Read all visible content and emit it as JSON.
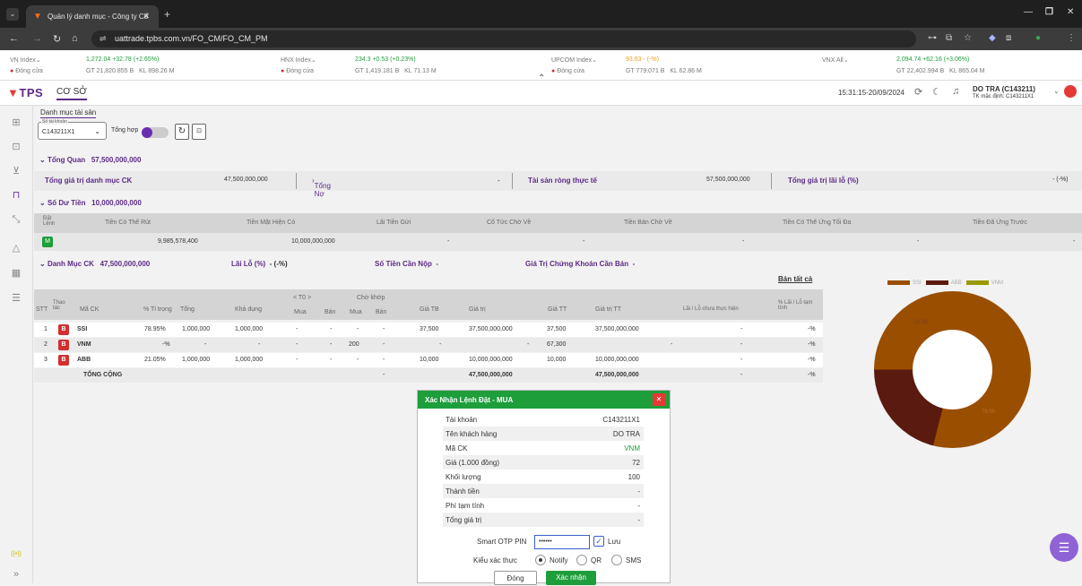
{
  "browser": {
    "tab_title": "Quản lý danh mục - Công ty Cổ",
    "url": "uattrade.tpbs.com.vn/FO_CM/FO_CM_PM"
  },
  "ticker": [
    {
      "name": "VN Index",
      "change": "1,272.04  +32.78  (+2.65%)",
      "state": "Đóng cửa",
      "gt": "GT 21,820.855 B",
      "kl": "KL 898.26 M"
    },
    {
      "name": "HNX Index",
      "change": "234.3  +0.53  (+0.23%)",
      "state": "Đóng cửa",
      "gt": "GT 1,419.181 B",
      "kl": "KL 71.13 M"
    },
    {
      "name": "UPCOM Index",
      "change": "93.63  -  (-%)",
      "state": "Đóng cửa",
      "gt": "GT 779.071 B",
      "kl": "KL 62.86 M"
    },
    {
      "name": "VNX All",
      "change": "2,094.74  +62.16  (+3.06%)",
      "state": "",
      "gt": "GT 22,402.994 B",
      "kl": "KL 865.04 M"
    }
  ],
  "header": {
    "logo": "TPS",
    "menu": "CƠ SỞ",
    "datetime": "15:31:15-20/09/2024",
    "user": "DO TRA (C143211)",
    "default_account": "TK mặc định: C143211X1"
  },
  "page": {
    "subtab": "Danh mục tài sản",
    "account_label": "Số tài khoản",
    "account": "C143211X1",
    "aggregate_label": "Tổng hợp",
    "overview_label": "Tổng Quan",
    "overview_value": "57,500,000,000",
    "overview": {
      "total_portfolio_label": "Tổng giá trị danh mục CK",
      "total_portfolio": "47,500,000,000",
      "debt_label": "Tổng Nợ",
      "debt_value": "-",
      "net_assets_label": "Tài sản ròng thực tế",
      "net_assets": "57,500,000,000",
      "pnl_label": "Tổng giá trị lãi lỗ (%)",
      "pnl_value": "- (-%)"
    },
    "cash_label": "Số Dư Tiền",
    "cash_value": "10,000,000,000",
    "cash_headers": [
      "Đặt Lệnh",
      "Tiền Có Thể Rút",
      "Tiền Mặt Hiện Có",
      "Lãi Tiền Gửi",
      "Cổ Tức Chờ Về",
      "Tiền Bán Chờ Về",
      "Tiền Có Thể Ứng Tối Đa",
      "Tiền Đã Ứng Trước"
    ],
    "cash_row": {
      "order_btn": "M",
      "withdrawable": "9,985,578,400",
      "cash": "10,000,000,000",
      "interest": "-",
      "dividend": "-",
      "sell_pending": "-",
      "max_advance": "-",
      "advanced": "-"
    },
    "portfolio_label": "Danh Mục CK",
    "portfolio_value": "47,500,000,000",
    "pnl_pct_label": "Lãi Lỗ (%)",
    "pnl_pct_value": "- (-%)",
    "pay_label": "Số Tiền Cần Nộp",
    "pay_value": "-",
    "sell_label": "Giá Trị Chứng Khoán Cần Bán",
    "sell_value": "-",
    "sell_all": "Bán tất cả",
    "headers": {
      "stt": "STT",
      "action": "Thao tác",
      "symbol": "Mã CK",
      "weight": "% Tỉ trọng",
      "total": "Tổng",
      "available": "Khả dụng",
      "t0": "< T0 >",
      "buy": "Mua",
      "sell": "Bán",
      "matching": "Chờ khớp",
      "buy2": "Mua",
      "sell2": "Bán",
      "avg": "Giá TB",
      "value": "Giá trị",
      "price": "Giá TT",
      "mvalue": "Giá trị TT",
      "pnl": "Lãi / Lỗ chưa thực hiện",
      "pnl_pct": "% Lãi / Lỗ tạm tính"
    },
    "rows": [
      {
        "stt": "1",
        "act": "B",
        "sym": "SSI",
        "w": "78.95%",
        "total": "1,000,000",
        "avail": "1,000,000",
        "t0b": "-",
        "t0s": "-",
        "mb": "-",
        "ms": "-",
        "avg": "37,500",
        "val": "37,500,000,000",
        "price": "37,500",
        "mval": "37,500,000,000",
        "pnl": "-",
        "pct": "-%"
      },
      {
        "stt": "2",
        "act": "B",
        "sym": "VNM",
        "w": "-%",
        "total": "-",
        "avail": "-",
        "t0b": "-",
        "t0s": "-",
        "mb": "200",
        "ms": "-",
        "avg": "-",
        "val": "-",
        "price": "67,300",
        "mval": "-",
        "pnl": "-",
        "pct": "-%"
      },
      {
        "stt": "3",
        "act": "B",
        "sym": "ABB",
        "w": "21.05%",
        "total": "1,000,000",
        "avail": "1,000,000",
        "t0b": "-",
        "t0s": "-",
        "mb": "-",
        "ms": "-",
        "avg": "10,000",
        "val": "10,000,000,000",
        "price": "10,000",
        "mval": "10,000,000,000",
        "pnl": "-",
        "pct": "-%"
      }
    ],
    "total_row": {
      "label": "TỔNG CỘNG",
      "mb": "-",
      "val": "47,500,000,000",
      "mval": "47,500,000,000",
      "pnl": "-",
      "pct": "-%"
    }
  },
  "chart_data": {
    "type": "pie",
    "categories": [
      "SSI",
      "ABB",
      "VNM"
    ],
    "values": [
      78.95,
      21.05,
      0
    ],
    "labels": [
      "78.95",
      "21.05"
    ],
    "colors": [
      "#9a4e00",
      "#5a1a10",
      "#9a9a00"
    ],
    "legend_position": "top"
  },
  "modal": {
    "title": "Xác Nhận Lệnh Đặt - MUA",
    "rows": [
      {
        "k": "Tài khoản",
        "v": "C143211X1"
      },
      {
        "k": "Tên khách hàng",
        "v": "DO TRA"
      },
      {
        "k": "Mã CK",
        "v": "VNM"
      },
      {
        "k": "Giá (1.000 đồng)",
        "v": "72"
      },
      {
        "k": "Khối lượng",
        "v": "100"
      },
      {
        "k": "Thành tiền",
        "v": "-"
      },
      {
        "k": "Phí tạm tính",
        "v": "-"
      },
      {
        "k": "Tổng giá trị",
        "v": "-"
      }
    ],
    "otp_label": "Smart OTP PIN",
    "otp_value": "••••••",
    "save_label": "Lưu",
    "auth_label": "Kiểu xác thực",
    "auth_options": [
      "Notify",
      "QR",
      "SMS"
    ],
    "close_btn": "Đóng",
    "confirm_btn": "Xác nhận"
  }
}
